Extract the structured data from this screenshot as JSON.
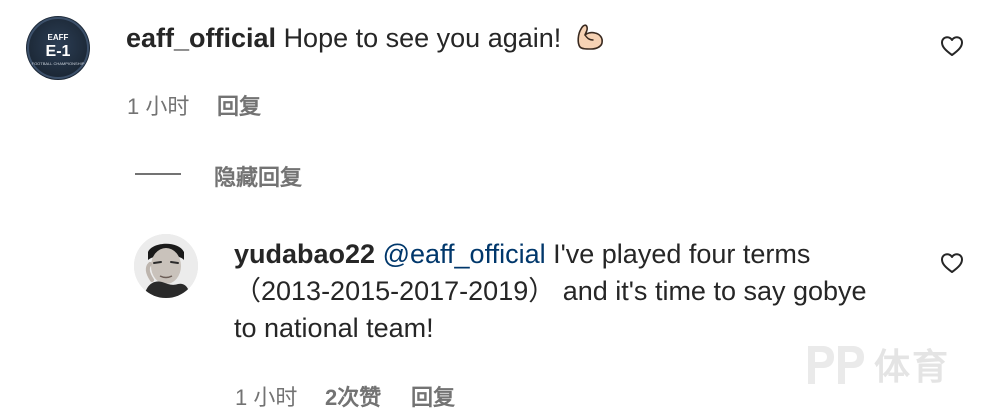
{
  "comment1": {
    "username": "eaff_official",
    "text": "Hope to see you again!",
    "emoji_icon": "flexed-biceps-icon",
    "time": "1 小时",
    "reply_label": "回复",
    "avatar_logo_text": "EAFF",
    "avatar_logo_big": "E-1",
    "avatar_logo_sub": "FOOTBALL CHAMPIONSHIP"
  },
  "hide_replies_label": "隐藏回复",
  "reply1": {
    "username": "yudabao22",
    "mention": "@eaff_official",
    "text_line1": "I've played four terms",
    "text_line2": "（2013-2015-2017-2019） and it's time to say gobye",
    "text_line3": "to national team!",
    "time": "1 小时",
    "likes": "2次赞",
    "reply_label": "回复"
  },
  "watermark": {
    "text": "体育"
  },
  "colors": {
    "text": "#262626",
    "secondary": "#737373",
    "mention": "#00376b"
  }
}
